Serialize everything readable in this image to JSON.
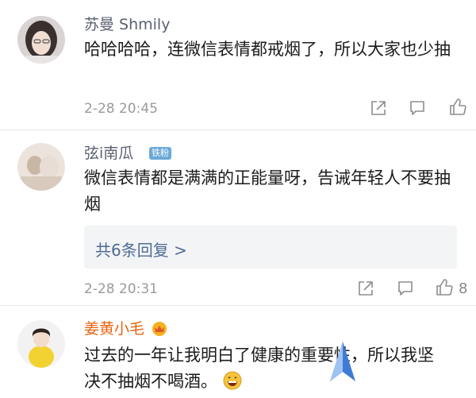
{
  "comments": [
    {
      "username": "苏曼 Shmily",
      "text": "哈哈哈哈，连微信表情都戒烟了，所以大家也少抽",
      "timestamp": "2-28 20:45",
      "icons": [
        "share-icon",
        "comment-icon",
        "like-icon"
      ]
    },
    {
      "username": "弦i南瓜",
      "badge": "铁粉",
      "text": "微信表情都是满满的正能量呀，告诫年轻人不要抽烟",
      "replies_label": "共6条回复 >",
      "timestamp": "2-28 20:31",
      "like_count": "8",
      "icons": [
        "share-icon",
        "comment-icon",
        "like-icon"
      ]
    },
    {
      "username": "姜黄小毛",
      "text_line1": "过去的一年让我明白了健康的重要性，所以我坚",
      "text_line2": "决不抽烟不喝酒。",
      "icons": [
        "crown-badge-icon",
        "grin-emoji-icon"
      ]
    }
  ],
  "colors": {
    "name_gray": "#5a6170",
    "name_vip": "#e8610c",
    "timestamp": "#9a9a9a",
    "reply_link": "#4e6b95",
    "divider": "#e6e6e6"
  }
}
